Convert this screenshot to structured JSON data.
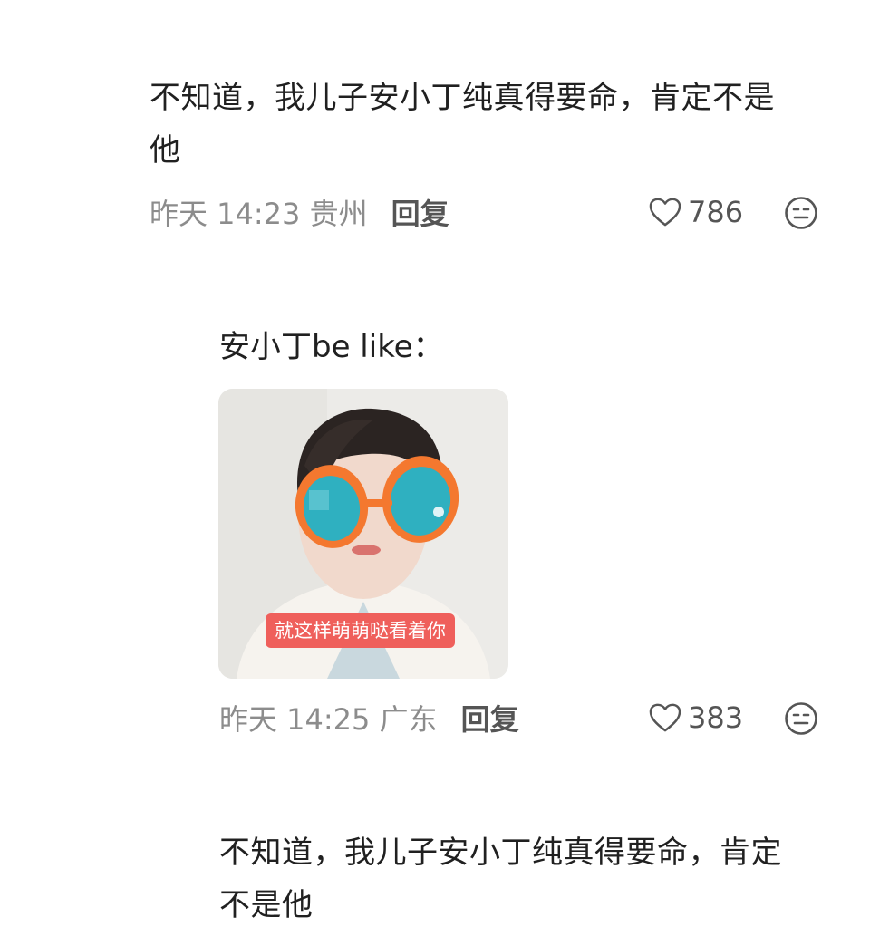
{
  "comments": [
    {
      "text": "不知道，我儿子安小丁纯真得要命，肯定不是\n他",
      "time_location": "昨天 14:23 贵州",
      "reply_label": "回复",
      "likes": "786"
    },
    {
      "text": "安小丁be like：",
      "sticker_caption": "就这样萌萌哒看着你",
      "time_location": "昨天 14:25 广东",
      "reply_label": "回复",
      "likes": "383"
    },
    {
      "text": "不知道，我儿子安小丁纯真得要命，肯定\n不是他"
    }
  ],
  "icons": {
    "like": "heart-outline-icon",
    "emoji": "emoji-face-icon"
  },
  "colors": {
    "meta_gray": "#8c8c8c",
    "icon_gray": "#555555",
    "sticker_caption_bg": "#ef5f5b",
    "glasses_orange": "#f4782f",
    "lens_teal": "#2fb0c0"
  }
}
